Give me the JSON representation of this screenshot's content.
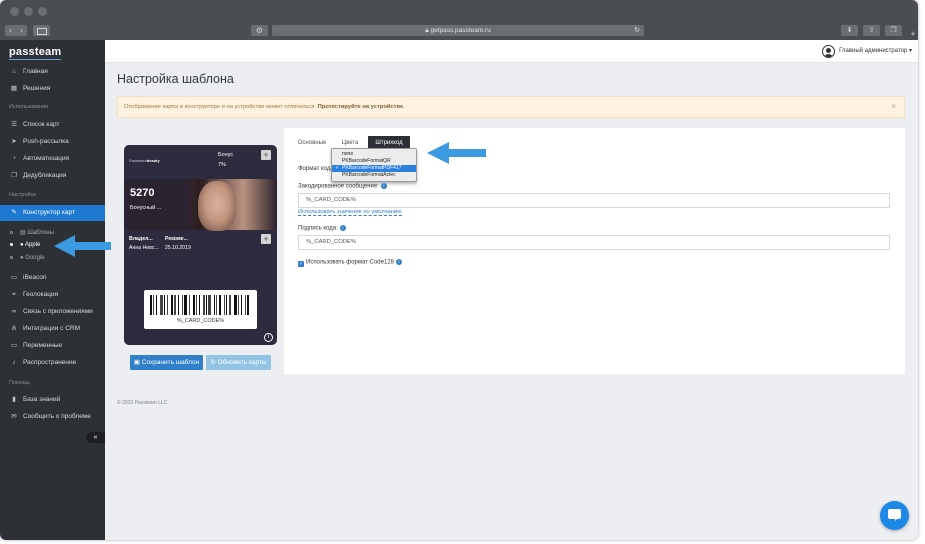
{
  "browser": {
    "url": "getpass.passteam.ru"
  },
  "sidebar": {
    "logo": "passteam",
    "items": [
      {
        "label": "Главная",
        "icon": "home-icon"
      },
      {
        "label": "Решения",
        "icon": "grid-icon"
      },
      {
        "section": "Использование"
      },
      {
        "label": "Список карт",
        "icon": "list-icon"
      },
      {
        "label": "Push-рассылка",
        "icon": "send-icon"
      },
      {
        "label": "Автоматизация",
        "icon": "gauge-icon"
      },
      {
        "label": "Дедубликация",
        "icon": "duplicate-icon"
      },
      {
        "section": "Настройка"
      },
      {
        "label": "Конструктор карт",
        "icon": "brush-icon"
      },
      {
        "label": "iBeacon",
        "icon": "monitor-icon"
      },
      {
        "label": "Геолокация",
        "icon": "location-icon"
      },
      {
        "label": "Связь с приложениями",
        "icon": "link-icon"
      },
      {
        "label": "Интеграции с CRM",
        "icon": "sitemap-icon"
      },
      {
        "label": "Переменные",
        "icon": "variables-icon"
      },
      {
        "label": "Распространение",
        "icon": "bell-icon"
      },
      {
        "section": "Помощь"
      },
      {
        "label": "База знаний",
        "icon": "book-icon"
      },
      {
        "label": "Сообщить о проблеме",
        "icon": "comment-icon"
      }
    ],
    "sub_items": [
      {
        "label": "Шаблоны",
        "icon": "template-icon"
      },
      {
        "label": "Apple",
        "icon": "apple-icon"
      },
      {
        "label": "Google",
        "icon": "google-icon"
      }
    ],
    "collapse": "«"
  },
  "topbar": {
    "user": "Главный администратор ▾"
  },
  "page": {
    "title": "Настройка шаблона",
    "alert_text": "Отображение карты в конструкторе и на устройстве может отличаться. ",
    "alert_strong": "Протестируйте на устройстве",
    "alert_end": ".",
    "alert_close": "×"
  },
  "pass": {
    "logo_light": "Passteam",
    "logo_bold": "beauty",
    "bonus_label": "Бонус",
    "bonus_value": "7%",
    "strip_value": "5270",
    "strip_label": "Бонусный ...",
    "fields": [
      {
        "label": "Владел...",
        "value": "Анна Невс..."
      },
      {
        "label": "Рекоме...",
        "value": "25.10.2019"
      }
    ],
    "barcode_text": "%_CARD_CODE%",
    "info": "i"
  },
  "buttons": {
    "save": "Сохранить шаблон",
    "refresh": "Обновить карты"
  },
  "tabs": [
    {
      "label": "Основные"
    },
    {
      "label": "Цвета"
    },
    {
      "label": "Штрихкод"
    }
  ],
  "form": {
    "format_label": "Формат кода:",
    "dropdown_options": [
      "none",
      "PKBarcodeFormatQR",
      "PKBarcodeFormatPDF417",
      "PKBarcodeFormatAztec"
    ],
    "dropdown_selected": "PKBarcodeFormatPDF417",
    "message_label": "Закодированное сообщение:",
    "message_value": "%_CARD_CODE%",
    "default_link": "Использовать значение по умолчанию",
    "caption_label": "Подпись кода:",
    "caption_value": "%_CARD_CODE%",
    "code128_label": "Использовать формат Code128"
  },
  "footer": "© 2019 Passteam LLC",
  "colors": {
    "accent": "#1e7ad1",
    "sidebar": "#2d3035",
    "arrow": "#3b9ae0"
  }
}
